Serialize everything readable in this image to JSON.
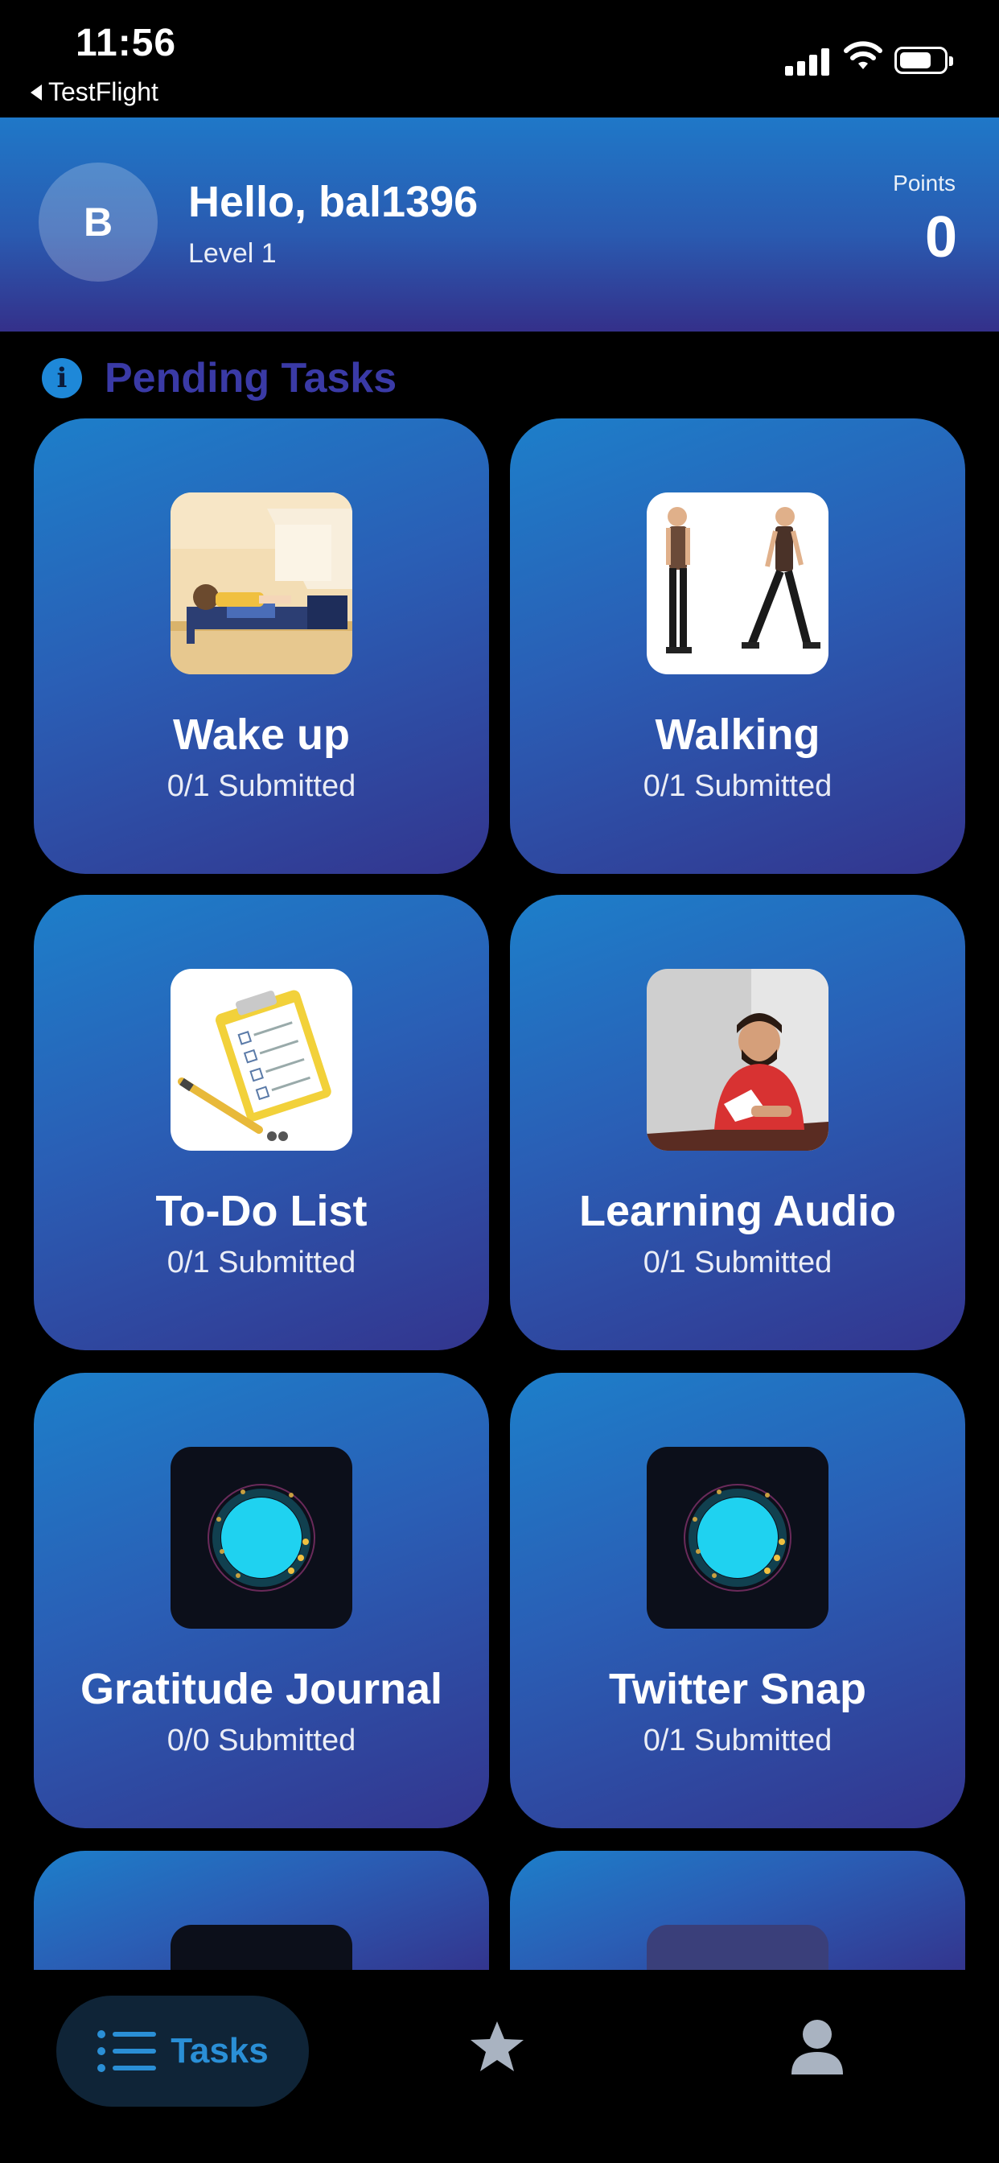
{
  "status_bar": {
    "time": "11:56",
    "back_label": "TestFlight"
  },
  "header": {
    "avatar_initial": "B",
    "greeting": "Hello, bal1396",
    "level": "Level 1",
    "points_label": "Points",
    "points_value": "0"
  },
  "section": {
    "title": "Pending Tasks",
    "info_icon": "info-icon"
  },
  "tasks": [
    {
      "title": "Wake up",
      "status": "0/1 Submitted",
      "image": "sleeping-person-illustration"
    },
    {
      "title": "Walking",
      "status": "0/1 Submitted",
      "image": "walking-man-illustration"
    },
    {
      "title": "To-Do List",
      "status": "0/1 Submitted",
      "image": "clipboard-checklist-illustration"
    },
    {
      "title": "Learning Audio",
      "status": "0/1 Submitted",
      "image": "man-reading-illustration"
    },
    {
      "title": "Gratitude Journal",
      "status": "0/0 Submitted",
      "image": "glowing-orb-icon"
    },
    {
      "title": "Twitter Snap",
      "status": "0/1 Submitted",
      "image": "glowing-orb-icon"
    }
  ],
  "nav": {
    "tabs": [
      {
        "label": "Tasks",
        "icon": "list-icon",
        "active": true
      },
      {
        "label": "",
        "icon": "star-icon",
        "active": false
      },
      {
        "label": "",
        "icon": "profile-icon",
        "active": false
      }
    ]
  },
  "colors": {
    "accent": "#2a8fd6",
    "section_title": "#3a3aa6",
    "card_gradient_top": "#1d7fca",
    "card_gradient_bottom": "#33358e",
    "background": "#000000"
  }
}
